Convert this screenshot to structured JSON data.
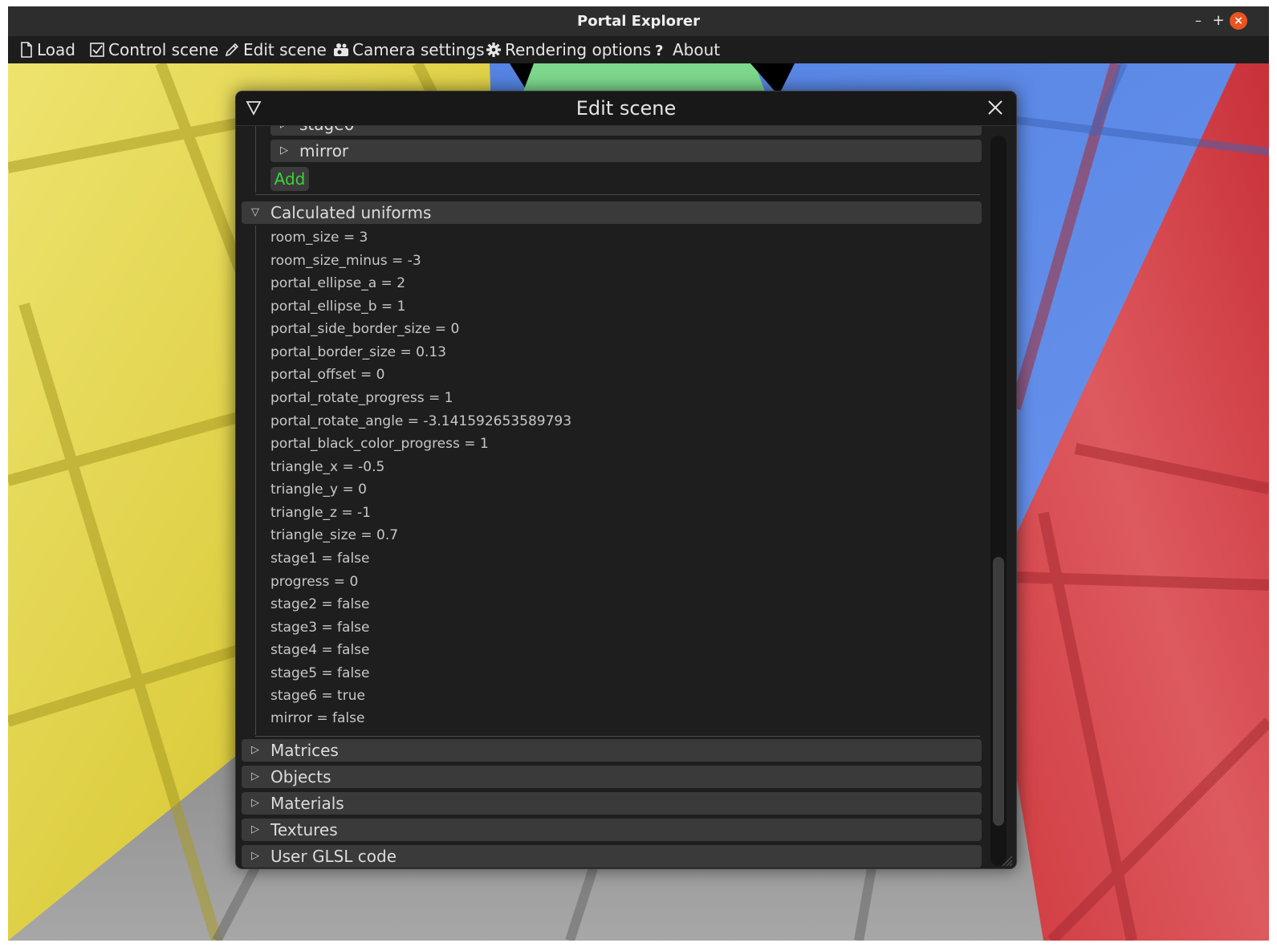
{
  "window": {
    "title": "Portal Explorer"
  },
  "window_controls": {
    "minimize": "–",
    "maximize": "+",
    "close": "×"
  },
  "menu": {
    "items": [
      {
        "label": "Load",
        "icon": "file-icon"
      },
      {
        "label": "Control scene",
        "icon": "checkbox-icon"
      },
      {
        "label": "Edit scene",
        "icon": "pencil-icon"
      },
      {
        "label": "Camera settings",
        "icon": "camera-icon"
      },
      {
        "label": "Rendering options",
        "icon": "gear-icon"
      },
      {
        "label": "About",
        "icon": "question-icon"
      }
    ]
  },
  "dialog": {
    "title": "Edit scene",
    "partial_item": "stage6",
    "mirror_label": "mirror",
    "add_label": "Add",
    "calculated_uniforms": {
      "label": "Calculated uniforms",
      "expanded": true,
      "items": [
        "room_size = 3",
        "room_size_minus = -3",
        "portal_ellipse_a = 2",
        "portal_ellipse_b = 1",
        "portal_side_border_size = 0",
        "portal_border_size = 0.13",
        "portal_offset = 0",
        "portal_rotate_progress = 1",
        "portal_rotate_angle = -3.141592653589793",
        "portal_black_color_progress = 1",
        "triangle_x = -0.5",
        "triangle_y = 0",
        "triangle_z = -1",
        "triangle_size = 0.7",
        "stage1 = false",
        "progress = 0",
        "stage2 = false",
        "stage3 = false",
        "stage4 = false",
        "stage5 = false",
        "stage6 = true",
        "mirror = false"
      ]
    },
    "sections": [
      {
        "label": "Matrices"
      },
      {
        "label": "Objects"
      },
      {
        "label": "Materials"
      },
      {
        "label": "Textures"
      },
      {
        "label": "User GLSL code"
      }
    ]
  },
  "colors": {
    "accent_green": "#39d23a",
    "close_button": "#e95420"
  }
}
